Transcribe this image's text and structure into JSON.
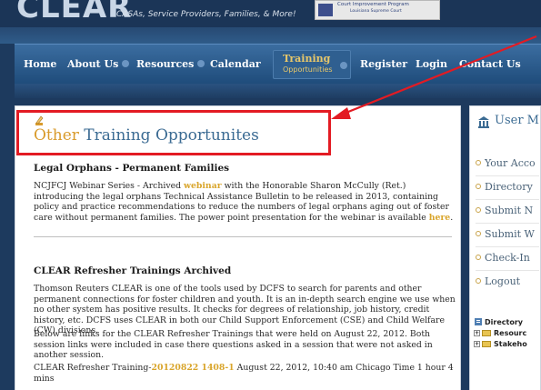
{
  "header": {
    "logo_text": "CLEAR",
    "tagline": "CASAs, Service Providers, Families, & More!",
    "badge_line1": "Court Improvement Program",
    "badge_line2": "Louisiana Supreme Court"
  },
  "nav": {
    "home": "Home",
    "about": "About Us",
    "resources": "Resources",
    "calendar": "Calendar",
    "training_l1": "Training",
    "training_l2": "Opportunities",
    "register": "Register",
    "login": "Login",
    "contact": "Contact Us"
  },
  "page": {
    "title_accent": "Other",
    "title_rest": " Training Opportunites"
  },
  "section1": {
    "heading": "Legal Orphans - Permanent Families",
    "text_before": "NCJFCJ Webinar Series - Archived ",
    "link1": "webinar",
    "text_middle": " with the Honorable Sharon McCully (Ret.) introducing the legal orphans Technical Assistance Bulletin to be released in 2013, containing policy and practice recommendations to reduce the numbers of legal orphans aging out of foster care without permanent families.  The power point presentation for the webinar is available ",
    "link2": "here",
    "text_end": "."
  },
  "section2": {
    "heading": "CLEAR Refresher Trainings Archived",
    "para1": "Thomson Reuters CLEAR is one of the tools used by DCFS to search for parents and other permanent connections for foster children and youth. It is an in-depth search engine we use when no other system has positive results. It checks for degrees of relationship, job history, credit history, etc. DCFS uses CLEAR in both our Child Support Enforcement (CSE) and Child Welfare (CW) divisions.",
    "para2": "Below are links for the CLEAR Refresher Trainings that were held on August 22, 2012. Both session links were included in case there questions asked in a session that were not asked in another session.",
    "para3_before": "CLEAR Refresher Training-",
    "para3_link": "20120822 1408-1",
    "para3_after": " August 22, 2012, 10:40 am Chicago Time 1 hour 4 mins"
  },
  "sidebar": {
    "title": "User M",
    "items": [
      "Your Acco",
      "Directory",
      "Submit N",
      "Submit W",
      "Check-In",
      "Logout"
    ],
    "tree_title": "Directory",
    "tree_rows": [
      "Resourc",
      "Stakeho"
    ]
  },
  "colors": {
    "accent": "#d9a52b",
    "title_blue": "#3b6b93",
    "annotation_red": "#e31b23"
  }
}
